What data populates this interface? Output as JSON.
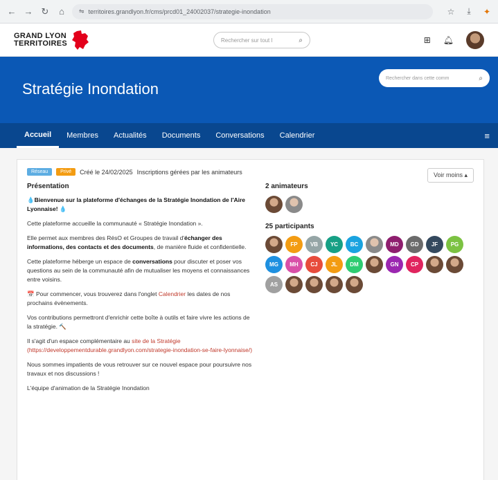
{
  "browser": {
    "url": "territoires.grandlyon.fr/cms/prcd01_24002037/strategie-inondation"
  },
  "site": {
    "logo_line1": "GRAND LYON",
    "logo_line2": "TERRITOIRES",
    "search_placeholder": "Rechercher sur tout l",
    "brand_red": "#e3001b"
  },
  "banner": {
    "title": "Stratégie Inondation",
    "search_placeholder": "Rechercher dans cette comm",
    "color": "#0b58b5"
  },
  "tabs": [
    {
      "label": "Accueil",
      "active": true
    },
    {
      "label": "Membres"
    },
    {
      "label": "Actualités"
    },
    {
      "label": "Documents"
    },
    {
      "label": "Conversations"
    },
    {
      "label": "Calendrier"
    }
  ],
  "meta": {
    "badge1": "Réseau",
    "badge2": "Privé",
    "created": "Créé le 24/02/2025",
    "registration": "Inscriptions gérées par les animateurs",
    "see_more": "Voir moins ▴"
  },
  "presentation": {
    "title": "Présentation",
    "welcome": "💧Bienvenue sur la plateforme d'échanges de la Stratégie Inondation de l'Aire Lyonnaise! 💧",
    "p1": "Cette plateforme accueille la communauté « Stratégie Inondation ».",
    "p2_pre": "Elle permet aux membres des RésO et Groupes de travail d'",
    "p2_bold": "échanger des informations, des contacts et des documents",
    "p2_post": ", de manière fluide et confidentielle.",
    "p3_pre": "Cette plateforme héberge un espace de ",
    "p3_bold": "conversations",
    "p3_post": " pour discuter et poser vos questions au sein de la communauté afin de mutualiser les moyens et connaissances entre voisins.",
    "p4_pre": "📅 Pour commencer, vous trouverez dans l'onglet ",
    "p4_link": "Calendrier",
    "p4_post": " les dates de nos prochains évènements.",
    "p5": "Vos contributions permettront d'enrichir cette boîte à outils et faire vivre les actions de la stratégie. 🔨",
    "p6_pre": "Il s'agit d'un espace complémentaire au ",
    "p6_link": "site de la Stratégie (https://developpementdurable.grandlyon.com/strategie-inondation-se-faire-lyonnaise/)",
    "p7": "Nous sommes impatients de vous retrouver sur ce nouvel espace pour poursuivre nos travaux et nos discussions !",
    "p8": "L'équipe d'animation de la Stratégie Inondation"
  },
  "animators": {
    "title": "2 animateurs"
  },
  "participants": {
    "title": "25 participants",
    "list": [
      {
        "initials": "",
        "color": "photo"
      },
      {
        "initials": "FP",
        "color": "#f39c12"
      },
      {
        "initials": "VB",
        "color": "#95a5a6"
      },
      {
        "initials": "YC",
        "color": "#16a085"
      },
      {
        "initials": "BC",
        "color": "#1aa3e0"
      },
      {
        "initials": "",
        "color": "photo2"
      },
      {
        "initials": "MD",
        "color": "#8e1e6e"
      },
      {
        "initials": "GD",
        "color": "#6b6b6b"
      },
      {
        "initials": "JF",
        "color": "#34495e"
      },
      {
        "initials": "PG",
        "color": "#7cc242"
      },
      {
        "initials": "MG",
        "color": "#1e90e0"
      },
      {
        "initials": "MH",
        "color": "#d94fa8"
      },
      {
        "initials": "CJ",
        "color": "#e74c3c"
      },
      {
        "initials": "JL",
        "color": "#f39c12"
      },
      {
        "initials": "DM",
        "color": "#2ecc71"
      },
      {
        "initials": "",
        "color": "photo"
      },
      {
        "initials": "GN",
        "color": "#9b27b0"
      },
      {
        "initials": "CP",
        "color": "#e0245e"
      },
      {
        "initials": "",
        "color": "photo"
      },
      {
        "initials": "",
        "color": "photo"
      },
      {
        "initials": "AS",
        "color": "#a0a0a0"
      },
      {
        "initials": "",
        "color": "photo"
      },
      {
        "initials": "",
        "color": "photo"
      },
      {
        "initials": "",
        "color": "photo"
      },
      {
        "initials": "",
        "color": "photo"
      }
    ]
  }
}
